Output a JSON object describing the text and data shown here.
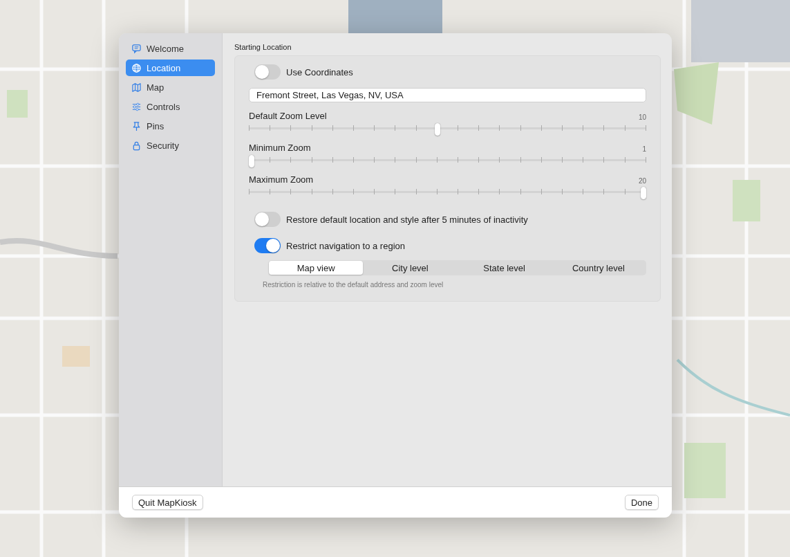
{
  "sidebar": {
    "items": [
      {
        "label": "Welcome",
        "selected": false
      },
      {
        "label": "Location",
        "selected": true
      },
      {
        "label": "Map",
        "selected": false
      },
      {
        "label": "Controls",
        "selected": false
      },
      {
        "label": "Pins",
        "selected": false
      },
      {
        "label": "Security",
        "selected": false
      }
    ]
  },
  "section": {
    "title": "Starting Location"
  },
  "use_coordinates": {
    "label": "Use Coordinates",
    "on": false
  },
  "address": {
    "value": "Fremont Street, Las Vegas, NV, USA"
  },
  "sliders": [
    {
      "label": "Default Zoom Level",
      "reading": "10",
      "level": 0.4737
    },
    {
      "label": "Minimum Zoom",
      "reading": "1",
      "level": 0
    },
    {
      "label": "Maximum Zoom",
      "reading": "20",
      "level": 1
    }
  ],
  "toggles": [
    {
      "label": "Restore default location and style after 5 minutes of inactivity",
      "on": false
    },
    {
      "label": "Restrict navigation to a region",
      "on": true
    }
  ],
  "segments": [
    {
      "label": "Map view",
      "selected": true
    },
    {
      "label": "City level",
      "selected": false
    },
    {
      "label": "State level",
      "selected": false
    },
    {
      "label": "Country level",
      "selected": false
    }
  ],
  "note": "Restriction is relative to the default address and zoom level",
  "footer": {
    "quit": "Quit MapKiosk",
    "done": "Done"
  }
}
